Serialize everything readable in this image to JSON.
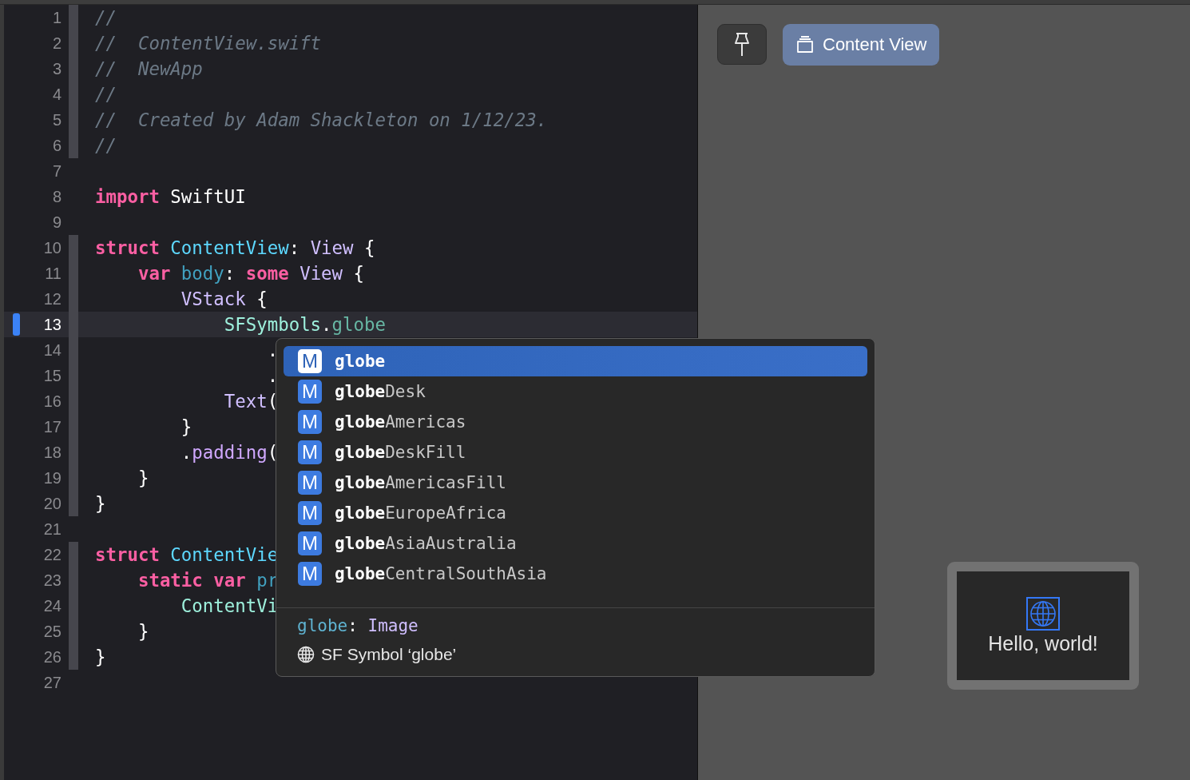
{
  "editor": {
    "lines": [
      {
        "number": "1",
        "fold": true,
        "current": false,
        "tokens": [
          {
            "kind": "comment",
            "text": "//"
          }
        ]
      },
      {
        "number": "2",
        "fold": true,
        "current": false,
        "tokens": [
          {
            "kind": "comment",
            "text": "//  ContentView.swift"
          }
        ]
      },
      {
        "number": "3",
        "fold": true,
        "current": false,
        "tokens": [
          {
            "kind": "comment",
            "text": "//  NewApp"
          }
        ]
      },
      {
        "number": "4",
        "fold": true,
        "current": false,
        "tokens": [
          {
            "kind": "comment",
            "text": "//"
          }
        ]
      },
      {
        "number": "5",
        "fold": true,
        "current": false,
        "tokens": [
          {
            "kind": "comment",
            "text": "//  Created by Adam Shackleton on 1/12/23."
          }
        ]
      },
      {
        "number": "6",
        "fold": true,
        "current": false,
        "tokens": [
          {
            "kind": "comment",
            "text": "//"
          }
        ]
      },
      {
        "number": "7",
        "fold": false,
        "current": false
      },
      {
        "number": "8",
        "fold": false,
        "current": false,
        "tokens": [
          {
            "kind": "keyword",
            "text": "import"
          },
          {
            "kind": "plain",
            "text": " SwiftUI"
          }
        ]
      },
      {
        "number": "9",
        "fold": false,
        "current": false
      },
      {
        "number": "10",
        "fold": true,
        "current": false,
        "tokens": [
          {
            "kind": "keyword",
            "text": "struct"
          },
          {
            "kind": "decl",
            "text": " ContentView"
          },
          {
            "kind": "plain",
            "text": ": "
          },
          {
            "kind": "type",
            "text": "View"
          },
          {
            "kind": "plain",
            "text": " {"
          }
        ]
      },
      {
        "number": "11",
        "fold": true,
        "current": false,
        "tokens": [
          {
            "kind": "keyword",
            "text": "    var"
          },
          {
            "kind": "var",
            "text": " body"
          },
          {
            "kind": "plain",
            "text": ": "
          },
          {
            "kind": "keyword",
            "text": "some"
          },
          {
            "kind": "type",
            "text": " View"
          },
          {
            "kind": "plain",
            "text": " {"
          }
        ]
      },
      {
        "number": "12",
        "fold": true,
        "current": false,
        "tokens": [
          {
            "kind": "type",
            "text": "        VStack"
          },
          {
            "kind": "plain",
            "text": " {"
          }
        ]
      },
      {
        "number": "13",
        "fold": true,
        "current": true,
        "tokens": [
          {
            "kind": "project",
            "text": "            SFSymbols"
          },
          {
            "kind": "plain",
            "text": "."
          },
          {
            "kind": "member",
            "text": "globe"
          }
        ]
      },
      {
        "number": "14",
        "fold": true,
        "current": false,
        "tokens": [
          {
            "kind": "plain",
            "text": "                ."
          }
        ]
      },
      {
        "number": "15",
        "fold": true,
        "current": false,
        "tokens": [
          {
            "kind": "plain",
            "text": "                ."
          }
        ]
      },
      {
        "number": "16",
        "fold": true,
        "current": false,
        "tokens": [
          {
            "kind": "type",
            "text": "            Text"
          },
          {
            "kind": "plain",
            "text": "("
          }
        ]
      },
      {
        "number": "17",
        "fold": true,
        "current": false,
        "tokens": [
          {
            "kind": "plain",
            "text": "        }"
          }
        ]
      },
      {
        "number": "18",
        "fold": true,
        "current": false,
        "tokens": [
          {
            "kind": "plain",
            "text": "        ."
          },
          {
            "kind": "method",
            "text": "padding"
          },
          {
            "kind": "plain",
            "text": "("
          }
        ]
      },
      {
        "number": "19",
        "fold": true,
        "current": false,
        "tokens": [
          {
            "kind": "plain",
            "text": "    }"
          }
        ]
      },
      {
        "number": "20",
        "fold": true,
        "current": false,
        "tokens": [
          {
            "kind": "plain",
            "text": "}"
          }
        ]
      },
      {
        "number": "21",
        "fold": false,
        "current": false
      },
      {
        "number": "22",
        "fold": true,
        "current": false,
        "tokens": [
          {
            "kind": "keyword",
            "text": "struct"
          },
          {
            "kind": "decl",
            "text": " ContentVie"
          }
        ]
      },
      {
        "number": "23",
        "fold": true,
        "current": false,
        "tokens": [
          {
            "kind": "keyword",
            "text": "    static var"
          },
          {
            "kind": "var",
            "text": " pr"
          }
        ]
      },
      {
        "number": "24",
        "fold": true,
        "current": false,
        "tokens": [
          {
            "kind": "project",
            "text": "        ContentVi"
          }
        ]
      },
      {
        "number": "25",
        "fold": true,
        "current": false,
        "tokens": [
          {
            "kind": "plain",
            "text": "    }"
          }
        ]
      },
      {
        "number": "26",
        "fold": true,
        "current": false,
        "tokens": [
          {
            "kind": "plain",
            "text": "}"
          }
        ]
      },
      {
        "number": "27",
        "fold": false,
        "current": false
      }
    ]
  },
  "completion": {
    "items": [
      {
        "badge": "M",
        "text": "**globe**",
        "selected": true
      },
      {
        "badge": "M",
        "text": "**globe**Desk",
        "selected": false
      },
      {
        "badge": "M",
        "text": "**globe**Americas",
        "selected": false
      },
      {
        "badge": "M",
        "text": "**globe**DeskFill",
        "selected": false
      },
      {
        "badge": "M",
        "text": "**globe**AmericasFill",
        "selected": false
      },
      {
        "badge": "M",
        "text": "**globe**EuropeAfrica",
        "selected": false
      },
      {
        "badge": "M",
        "text": "**globe**AsiaAustralia",
        "selected": false
      },
      {
        "badge": "M",
        "text": "**globe**CentralSouthAsia",
        "selected": false
      }
    ],
    "signature": {
      "name": "globe",
      "separator": ": ",
      "type": "Image"
    },
    "description": "SF Symbol ‘globe’"
  },
  "preview": {
    "pin_selected": false,
    "view_button": {
      "label": "Content View",
      "selected": true
    },
    "canvas": {
      "text": "Hello, world!",
      "symbol_selected": true
    }
  }
}
